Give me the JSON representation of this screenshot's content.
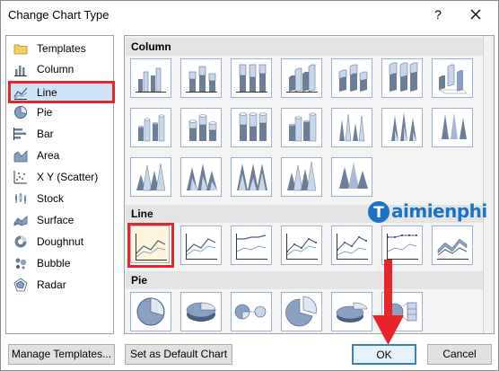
{
  "window": {
    "title": "Change Chart Type",
    "help": "?",
    "close_icon": "close-icon"
  },
  "sidebar": {
    "items": [
      {
        "label": "Templates",
        "icon": "folder-icon"
      },
      {
        "label": "Column",
        "icon": "column-chart-icon"
      },
      {
        "label": "Line",
        "icon": "line-chart-icon",
        "selected": true
      },
      {
        "label": "Pie",
        "icon": "pie-chart-icon"
      },
      {
        "label": "Bar",
        "icon": "bar-chart-icon"
      },
      {
        "label": "Area",
        "icon": "area-chart-icon"
      },
      {
        "label": "X Y (Scatter)",
        "icon": "scatter-chart-icon"
      },
      {
        "label": "Stock",
        "icon": "stock-chart-icon"
      },
      {
        "label": "Surface",
        "icon": "surface-chart-icon"
      },
      {
        "label": "Doughnut",
        "icon": "doughnut-chart-icon"
      },
      {
        "label": "Bubble",
        "icon": "bubble-chart-icon"
      },
      {
        "label": "Radar",
        "icon": "radar-chart-icon"
      }
    ]
  },
  "gallery": {
    "sections": [
      {
        "label": "Column",
        "count": 19
      },
      {
        "label": "Line",
        "count": 7,
        "selected_index": 0
      },
      {
        "label": "Pie",
        "count": 6
      }
    ]
  },
  "watermark": {
    "text": "aimienphi",
    "logo_letter": "T"
  },
  "buttons": {
    "manage_templates": "Manage Templates...",
    "set_default": "Set as Default Chart",
    "ok": "OK",
    "cancel": "Cancel"
  },
  "colors": {
    "highlight": "#e8262a",
    "accent": "#1a73c9",
    "tile_border": "#9bb3cf"
  }
}
